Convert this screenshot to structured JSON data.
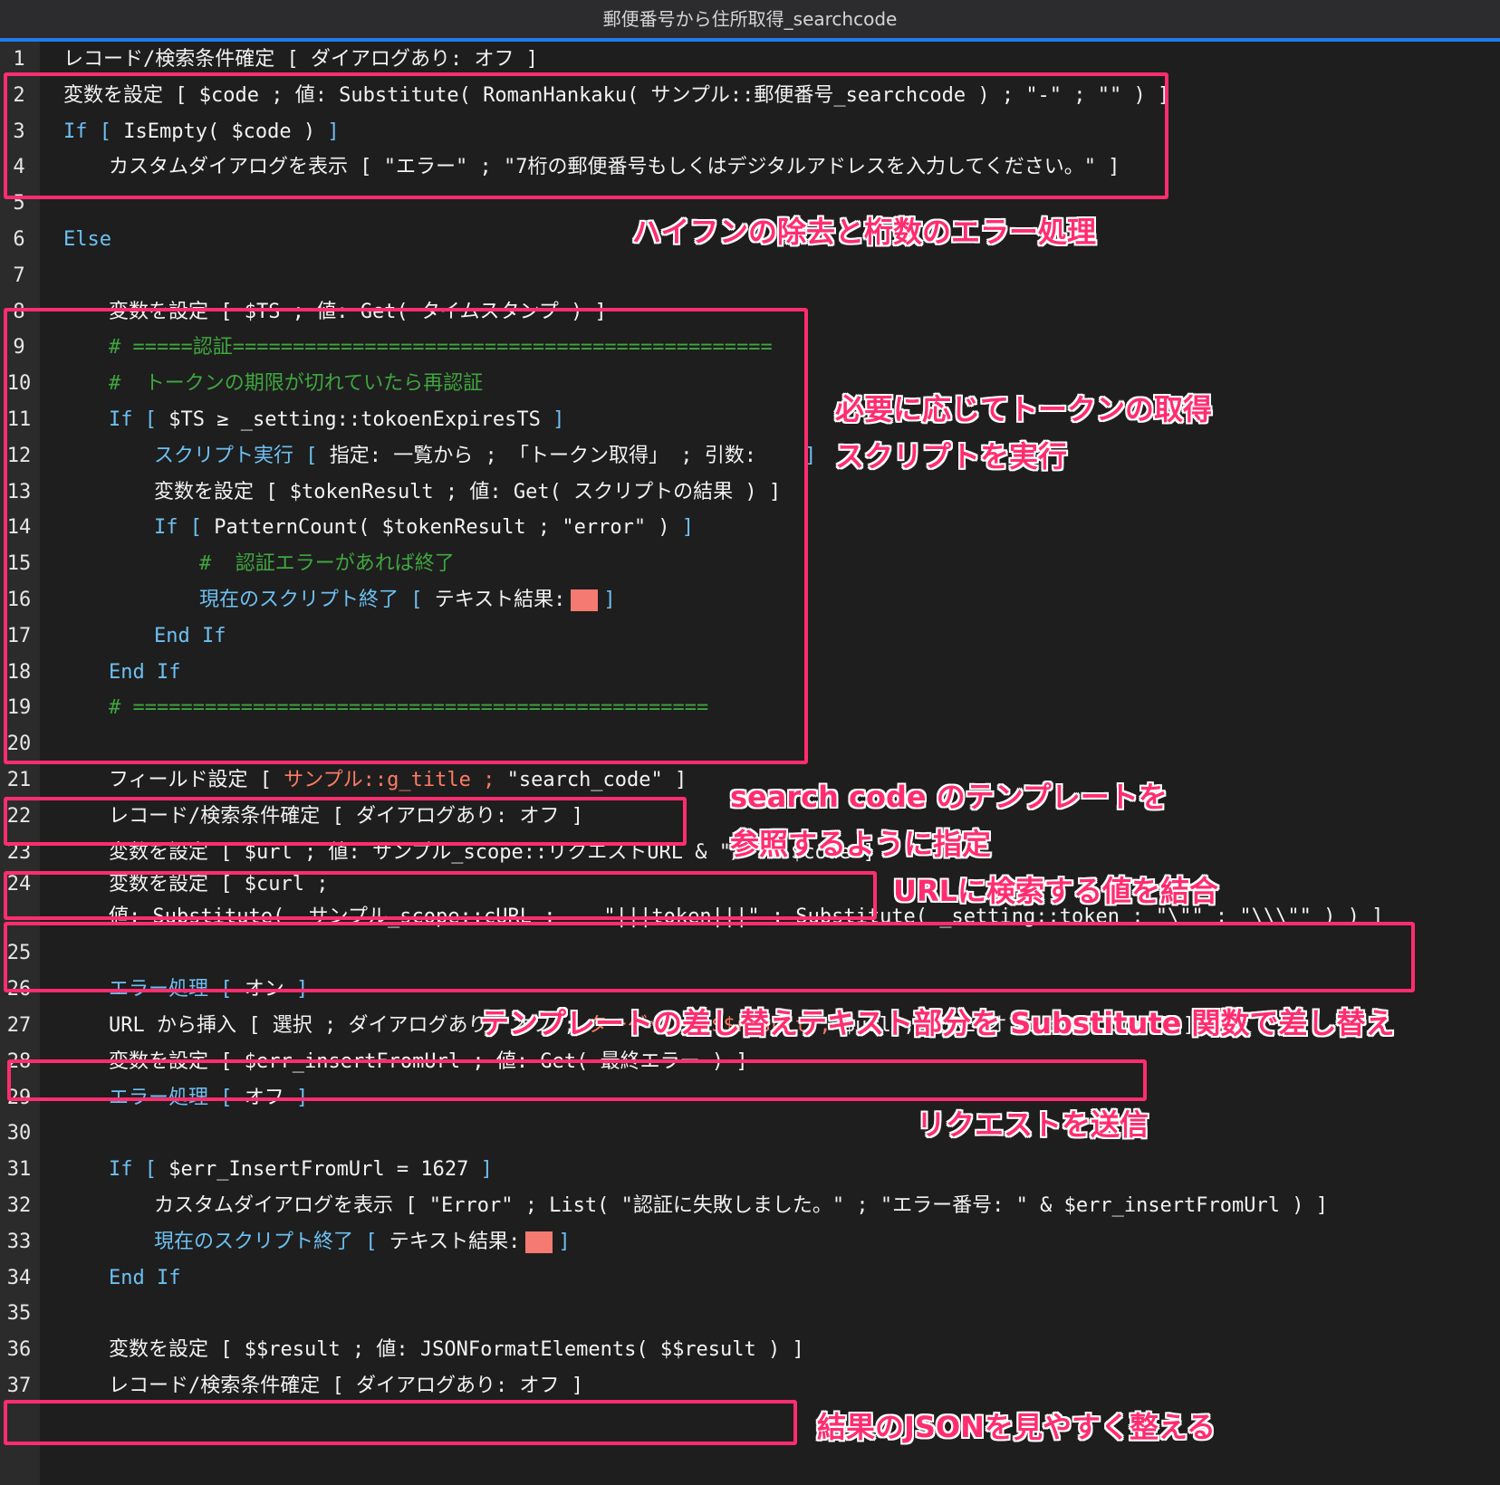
{
  "window": {
    "title": "郵便番号から住所取得_searchcode"
  },
  "colors": {
    "keyword": "#6dc0f2",
    "comment": "#3fa63f",
    "field_ref": "#ff7b63",
    "annotation": "#ff2d6f",
    "accent": "#1d7df0"
  },
  "lines": [
    {
      "n": "1",
      "segs": [
        {
          "t": "レコード/検索条件確定 [ ダイアログあり: オフ ]",
          "c": ""
        }
      ]
    },
    {
      "n": "2",
      "segs": [
        {
          "t": "変数を設定 [ $code ; 値: Substitute( RomanHankaku( サンプル::郵便番号_searchcode ) ; \"-\" ; \"\" ) ]",
          "c": ""
        }
      ]
    },
    {
      "n": "3",
      "segs": [
        {
          "t": "If [ ",
          "c": "kw"
        },
        {
          "t": "IsEmpty( $code ) ",
          "c": ""
        },
        {
          "t": "]",
          "c": "kw"
        }
      ]
    },
    {
      "n": "4",
      "segs": [
        {
          "t": "カスタムダイアログを表示 [ \"エラー\" ; \"7桁の郵便番号もしくはデジタルアドレスを入力してください。\" ]",
          "c": ""
        }
      ]
    },
    {
      "n": "5",
      "segs": []
    },
    {
      "n": "6",
      "segs": [
        {
          "t": "Else",
          "c": "kw"
        }
      ]
    },
    {
      "n": "7",
      "segs": []
    },
    {
      "n": "8",
      "segs": [
        {
          "t": "変数を設定 [ $TS ; 値: Get( タイムスタンプ ) ]",
          "c": ""
        }
      ]
    },
    {
      "n": "9",
      "segs": [
        {
          "t": "# =====認証=============================================",
          "c": "cm"
        }
      ]
    },
    {
      "n": "10",
      "segs": [
        {
          "t": "#  トークンの期限が切れていたら再認証",
          "c": "cm"
        }
      ]
    },
    {
      "n": "11",
      "segs": [
        {
          "t": "If [ ",
          "c": "kw"
        },
        {
          "t": "$TS ≥ _setting::tokoenExpiresTS ",
          "c": ""
        },
        {
          "t": "]",
          "c": "kw"
        }
      ]
    },
    {
      "n": "12",
      "segs": [
        {
          "t": "スクリプト実行 [ ",
          "c": "kw"
        },
        {
          "t": "指定: 一覧から ; 「トークン取得」 ; 引数:    ",
          "c": ""
        },
        {
          "t": "]",
          "c": "kw"
        }
      ]
    },
    {
      "n": "13",
      "segs": [
        {
          "t": "変数を設定 [ $tokenResult ; 値: Get( スクリプトの結果 ) ]",
          "c": ""
        }
      ]
    },
    {
      "n": "14",
      "segs": [
        {
          "t": "If [ ",
          "c": "kw"
        },
        {
          "t": "PatternCount( $tokenResult ; \"error\" ) ",
          "c": ""
        },
        {
          "t": "]",
          "c": "kw"
        }
      ]
    },
    {
      "n": "15",
      "segs": [
        {
          "t": "#  認証エラーがあれば終了",
          "c": "cm"
        }
      ]
    },
    {
      "n": "16",
      "segs": [
        {
          "t": "現在のスクリプト終了 [ ",
          "c": "kw"
        },
        {
          "t": "テキスト結果:",
          "c": ""
        },
        {
          "t": "",
          "c": "swatch"
        },
        {
          "t": "]",
          "c": "kw"
        }
      ]
    },
    {
      "n": "17",
      "segs": [
        {
          "t": "End If",
          "c": "kw"
        }
      ]
    },
    {
      "n": "18",
      "segs": [
        {
          "t": "End If",
          "c": "kw"
        }
      ]
    },
    {
      "n": "19",
      "segs": [
        {
          "t": "# ================================================",
          "c": "cm"
        }
      ]
    },
    {
      "n": "20",
      "segs": []
    },
    {
      "n": "21",
      "segs": [
        {
          "t": "フィールド設定 [ ",
          "c": ""
        },
        {
          "t": "サンプル::g_title ; ",
          "c": "ref"
        },
        {
          "t": "\"search_code\" ]",
          "c": ""
        }
      ]
    },
    {
      "n": "22",
      "segs": [
        {
          "t": "レコード/検索条件確定 [ ダイアログあり: オフ ]",
          "c": ""
        }
      ]
    },
    {
      "n": "23",
      "segs": [
        {
          "t": "変数を設定 [ $url ; 値: サンプル_scope::リクエストURL & \"/\" & $code ]",
          "c": ""
        }
      ]
    },
    {
      "n": "24",
      "segs": [
        {
          "t": "変数を設定 [ $curl ;",
          "c": ""
        }
      ],
      "cont": "値: Substitute(  サンプル_scope::cURL ;    \"|||token|||\" ; Substitute( _setting::token ; \"\\\"\" ; \"\\\\\\\"\" ) ) ]"
    },
    {
      "n": "25",
      "segs": []
    },
    {
      "n": "26",
      "segs": [
        {
          "t": "エラー処理 [ ",
          "c": "kw"
        },
        {
          "t": "オン ",
          "c": ""
        },
        {
          "t": "]",
          "c": "kw"
        }
      ]
    },
    {
      "n": "27",
      "segs": [
        {
          "t": "URL から挿入 [ 選択 ; ダイアログあり: オフ ; ",
          "c": ""
        },
        {
          "t": "ターゲット: $$result ; ",
          "c": "ref"
        },
        {
          "t": "$url ; cURL オプション: $curl ]",
          "c": ""
        }
      ]
    },
    {
      "n": "28",
      "segs": [
        {
          "t": "変数を設定 [ $err_insertFromUrl ; 値: Get( 最終エラー ) ]",
          "c": ""
        }
      ]
    },
    {
      "n": "29",
      "segs": [
        {
          "t": "エラー処理 [ ",
          "c": "kw"
        },
        {
          "t": "オフ ",
          "c": ""
        },
        {
          "t": "]",
          "c": "kw"
        }
      ]
    },
    {
      "n": "30",
      "segs": []
    },
    {
      "n": "31",
      "segs": [
        {
          "t": "If [ ",
          "c": "kw"
        },
        {
          "t": "$err_InsertFromUrl = 1627 ",
          "c": ""
        },
        {
          "t": "]",
          "c": "kw"
        }
      ]
    },
    {
      "n": "32",
      "segs": [
        {
          "t": "カスタムダイアログを表示 [ \"Error\" ; List( \"認証に失敗しました。\" ; \"エラー番号: \" & $err_insertFromUrl ) ]",
          "c": ""
        }
      ]
    },
    {
      "n": "33",
      "segs": [
        {
          "t": "現在のスクリプト終了 [ ",
          "c": "kw"
        },
        {
          "t": "テキスト結果:",
          "c": ""
        },
        {
          "t": "",
          "c": "swatch"
        },
        {
          "t": "]",
          "c": "kw"
        }
      ]
    },
    {
      "n": "34",
      "segs": [
        {
          "t": "End If",
          "c": "kw"
        }
      ]
    },
    {
      "n": "35",
      "segs": []
    },
    {
      "n": "36",
      "segs": [
        {
          "t": "変数を設定 [ $$result ; 値: JSONFormatElements( $$result ) ]",
          "c": ""
        }
      ]
    },
    {
      "n": "37",
      "segs": [
        {
          "t": "レコード/検索条件確定 [ ダイアログあり: オフ ]",
          "c": ""
        }
      ]
    }
  ],
  "annotations": {
    "a1": "ハイフンの除去と桁数のエラー処理",
    "a2": "必要に応じてトークンの取得\nスクリプトを実行",
    "a3": "search code のテンプレートを\n参照するように指定",
    "a4": "URLに検索する値を結合",
    "a5": "テンプレートの差し替えテキスト部分を Substitute 関数で差し替え",
    "a6": "リクエストを送信",
    "a7": "結果のJSONを見やすく整える"
  }
}
